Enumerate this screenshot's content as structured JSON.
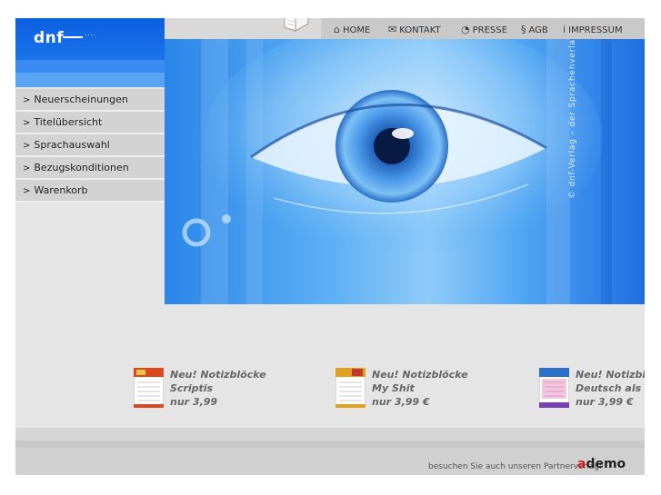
{
  "logo": {
    "text": "dnf"
  },
  "sidebar": {
    "items": [
      {
        "label": "Neuerscheinungen"
      },
      {
        "label": "Titelübersicht"
      },
      {
        "label": "Sprachauswahl"
      },
      {
        "label": "Bezugskonditionen"
      },
      {
        "label": "Warenkorb"
      }
    ]
  },
  "nav": {
    "items": [
      {
        "label": "HOME",
        "icon": "house-icon"
      },
      {
        "label": "KONTAKT",
        "icon": "envelope-icon"
      },
      {
        "label": "PRESSE",
        "icon": "speech-bubble-icon"
      },
      {
        "label": "AGB",
        "icon": "paragraph-icon"
      },
      {
        "label": "IMPRESSUM",
        "icon": "info-icon"
      }
    ]
  },
  "hero": {
    "credit": "© dnf-Verlag – der Sprachenverlag"
  },
  "products": [
    {
      "line1": "Neu! Notizblöcke",
      "line2": "Scriptis",
      "line3": "nur 3,99"
    },
    {
      "line1": "Neu! Notizblöcke",
      "line2": "My Shit",
      "line3": "nur 3,99 €"
    },
    {
      "line1": "Neu! Notizblo",
      "line2": "Deutsch als F",
      "line3": "nur 3,99 €"
    }
  ],
  "footer": {
    "text": "besuchen Sie auch unseren Partnerverlag:",
    "partner_logo_a": "a",
    "partner_logo_rest": "demo"
  },
  "colors": {
    "brand_blue": "#0b5fe0",
    "sidebar_gray": "#d3d3d3",
    "background": "#e5e5e5"
  }
}
